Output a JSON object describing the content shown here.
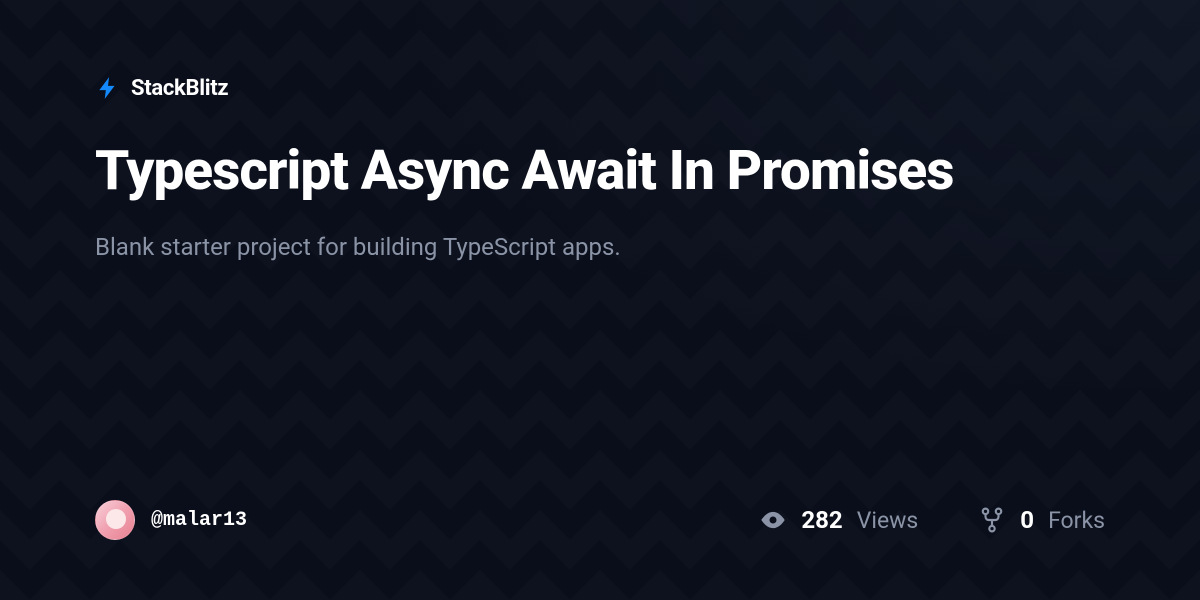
{
  "brand": {
    "name": "StackBlitz",
    "accent_color": "#1389fd"
  },
  "project": {
    "title": "Typescript Async Await In Promises",
    "description": "Blank starter project for building TypeScript apps."
  },
  "author": {
    "username": "@malar13"
  },
  "stats": {
    "views": {
      "count": "282",
      "label": "Views"
    },
    "forks": {
      "count": "0",
      "label": "Forks"
    }
  }
}
